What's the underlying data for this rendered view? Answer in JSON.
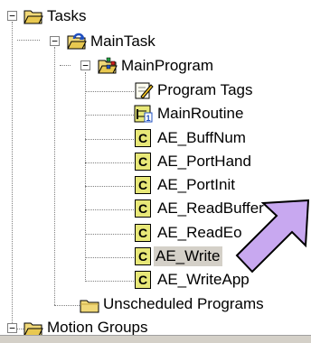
{
  "tree": {
    "tasks": "Tasks",
    "main_task": "MainTask",
    "main_program": "MainProgram",
    "program_tags": "Program Tags",
    "main_routine": "MainRoutine",
    "routines": [
      "AE_BuffNum",
      "AE_PortHand",
      "AE_PortInit",
      "AE_ReadBuffer",
      "AE_ReadEo",
      "AE_Write",
      "AE_WriteApp"
    ],
    "unscheduled_programs": "Unscheduled Programs",
    "motion_groups": "Motion Groups",
    "selected_routine": "AE_Write"
  },
  "colors": {
    "folder": "#f0d878",
    "selection": "#d4d0c8",
    "arrow_fill": "#c8a8f0",
    "arrow_stroke": "#000000"
  }
}
